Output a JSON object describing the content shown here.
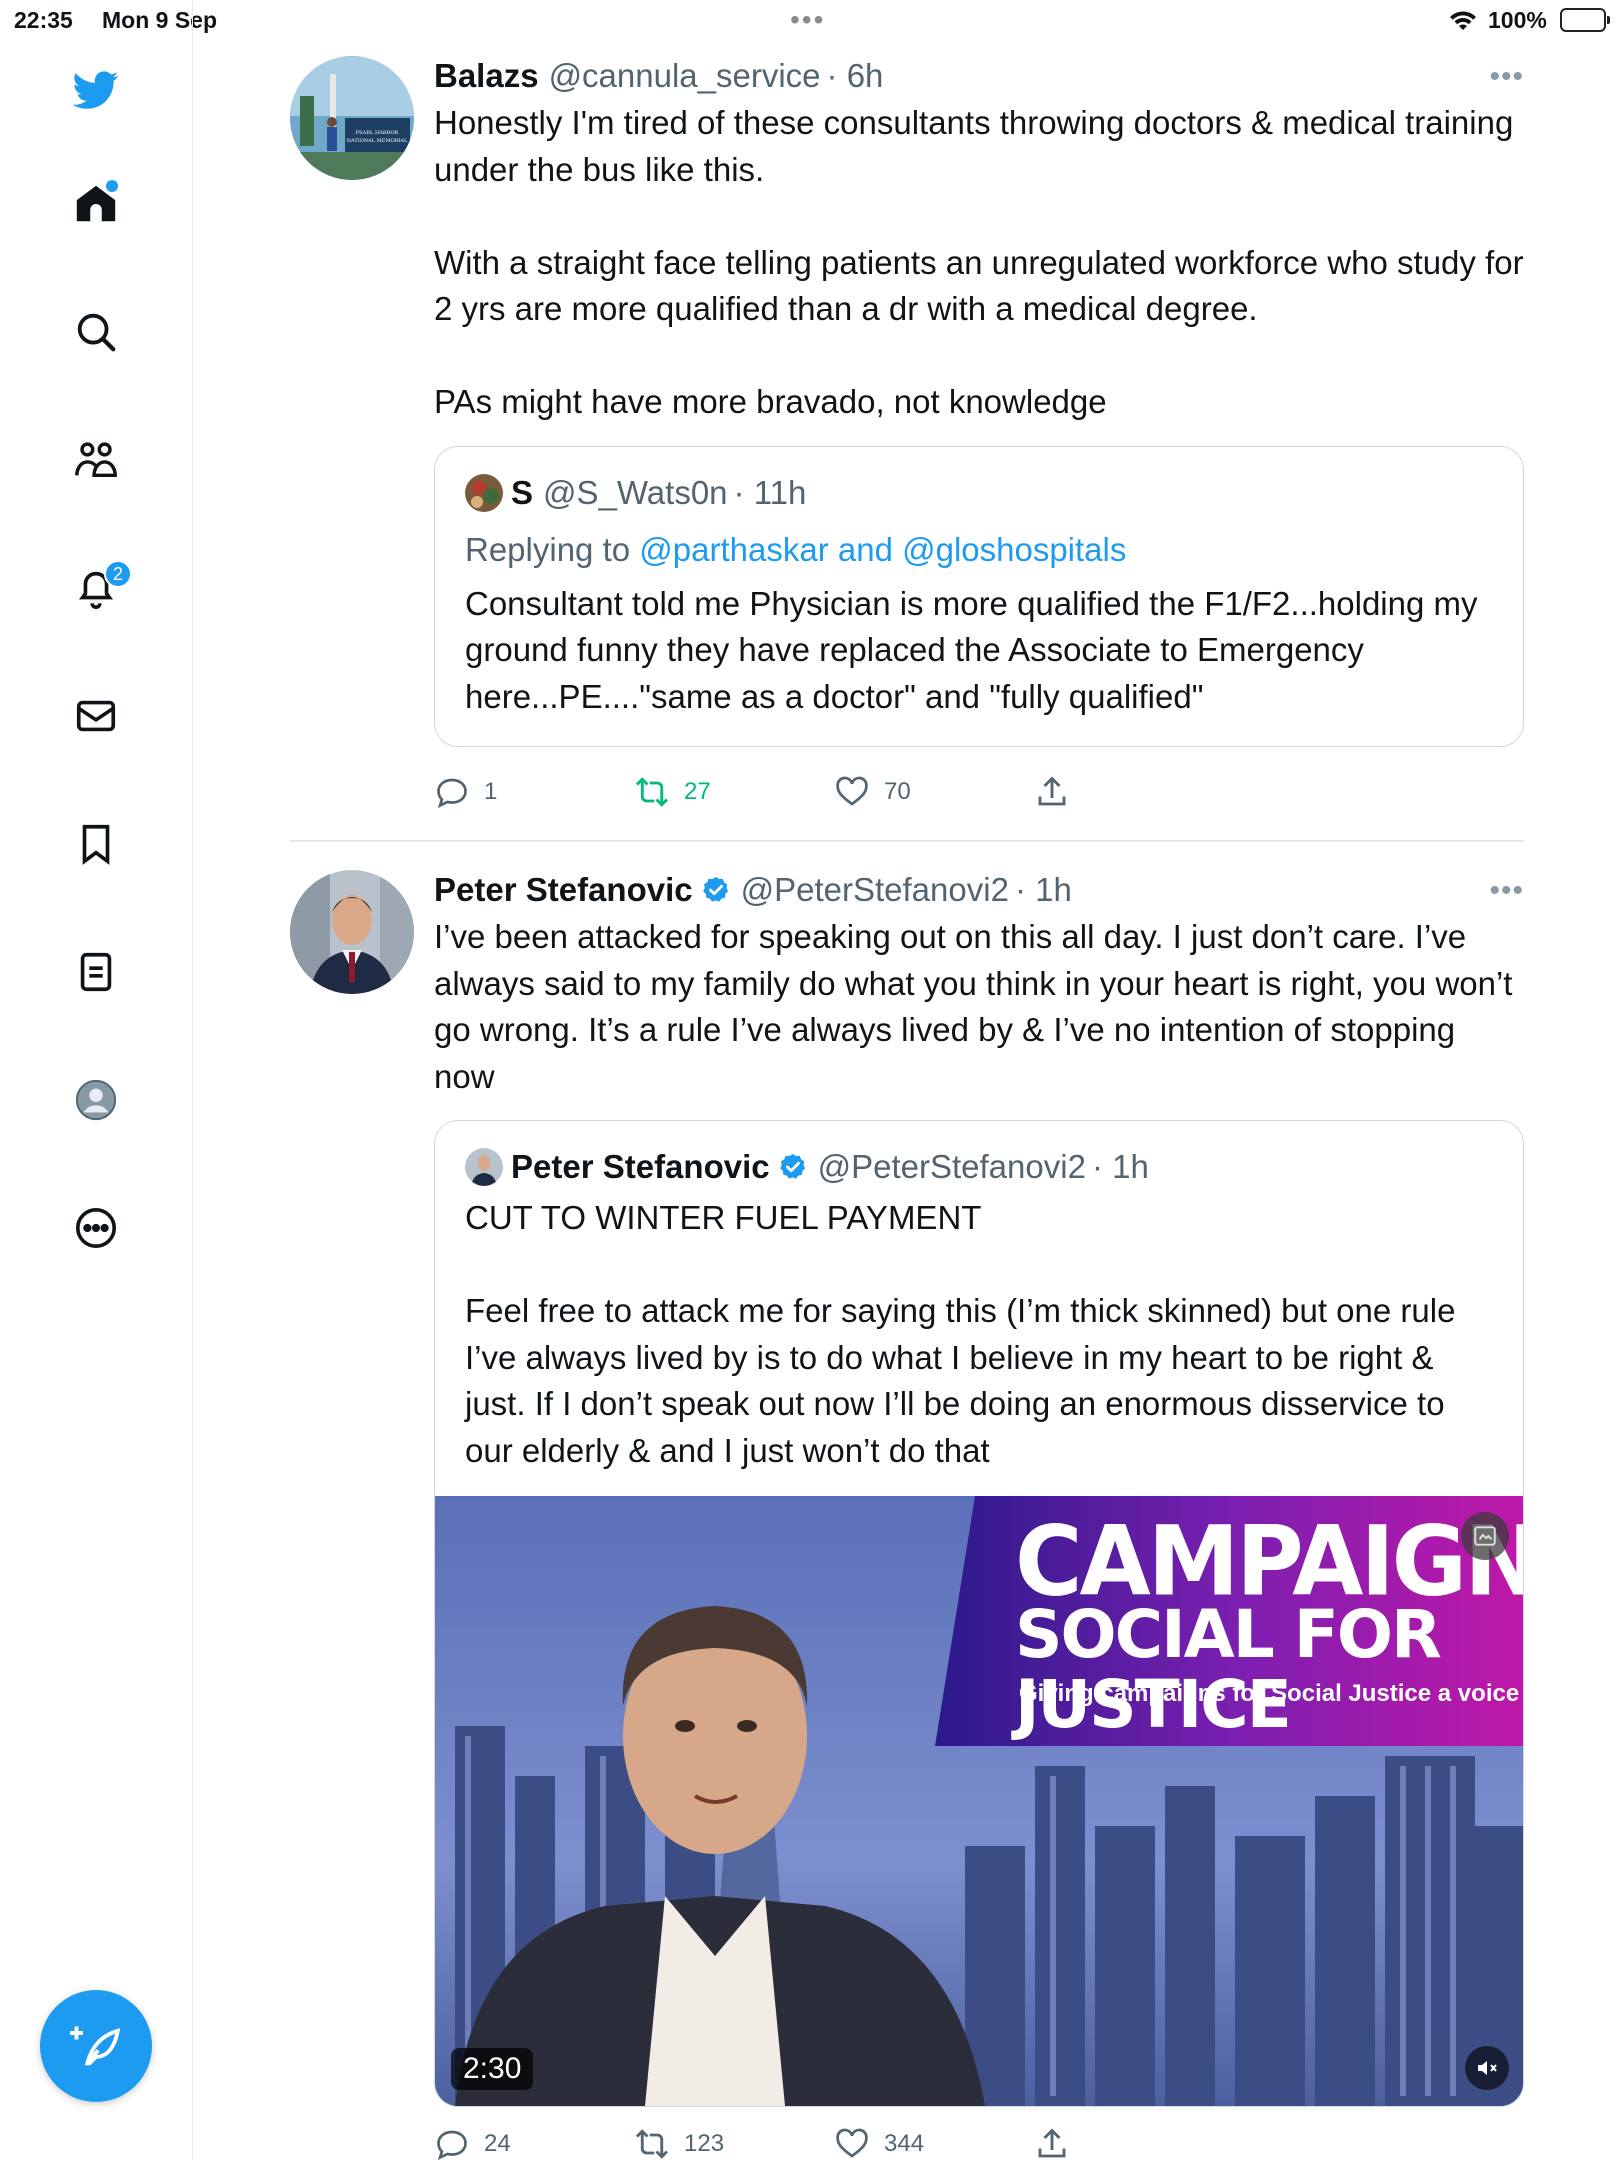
{
  "status_bar": {
    "time": "22:35",
    "date": "Mon 9 Sep",
    "battery": "100%",
    "battery_color": "#34c759"
  },
  "sidebar": {
    "items": [
      {
        "icon": "twitter-logo-icon"
      },
      {
        "icon": "home-icon",
        "has_dot": true
      },
      {
        "icon": "search-icon"
      },
      {
        "icon": "communities-icon"
      },
      {
        "icon": "notifications-icon",
        "badge": "2"
      },
      {
        "icon": "messages-icon"
      },
      {
        "icon": "bookmarks-icon"
      },
      {
        "icon": "lists-icon"
      },
      {
        "icon": "profile-icon"
      },
      {
        "icon": "more-icon"
      }
    ],
    "compose_icon": "compose-tweet-icon",
    "accent": "#1d9bf0"
  },
  "tweets": [
    {
      "name": "Balazs",
      "handle": "@cannula_service",
      "time": "· 6h",
      "text": "Honestly I'm tired of these consultants throwing doctors & medical training under the bus like this.\n\nWith a straight face telling patients an unregulated workforce who study for 2 yrs are more qualified than a dr with a medical degree.\n\nPAs might have more bravado, not knowledge",
      "quote": {
        "name": "S",
        "handle": "@S_Wats0n",
        "time": "· 11h",
        "replying_prefix": "Replying to",
        "replying_to": "@parthaskar and @gloshospitals",
        "text": "Consultant told me Physician is more qualified the F1/F2...holding my ground funny they have replaced the Associate to Emergency here...PE....\"same as a doctor\" and \"fully qualified\""
      },
      "replies": "1",
      "retweets": "27",
      "likes": "70"
    },
    {
      "name": "Peter Stefanovic",
      "handle": "@PeterStefanovi2",
      "time": "· 1h",
      "verified": true,
      "text": "I’ve been attacked for speaking out on this all day. I just don’t care. I’ve always said to my family do what you think in your heart is right, you won’t go wrong. It’s a rule I’ve always lived by & I’ve no intention of stopping now",
      "quote": {
        "name": "Peter Stefanovic",
        "handle": "@PeterStefanovi2",
        "time": "· 1h",
        "verified": true,
        "text": "CUT TO WINTER FUEL PAYMENT\n\nFeel free to attack me for saying this (I’m thick skinned) but one rule I’ve always lived by is to do what I believe in my heart to be right & just. If I don’t speak out now I’ll be doing an enormous disservice to our elderly & and I just won’t do that",
        "video": {
          "duration": "2:30",
          "banner_line1": "CAMPAIGN",
          "banner_line2": "SOCIAL FOR JUSTICE",
          "banner_line3": "Giving campaigns for Social Justice a voice"
        }
      },
      "replies": "24",
      "retweets": "123",
      "likes": "344"
    }
  ]
}
